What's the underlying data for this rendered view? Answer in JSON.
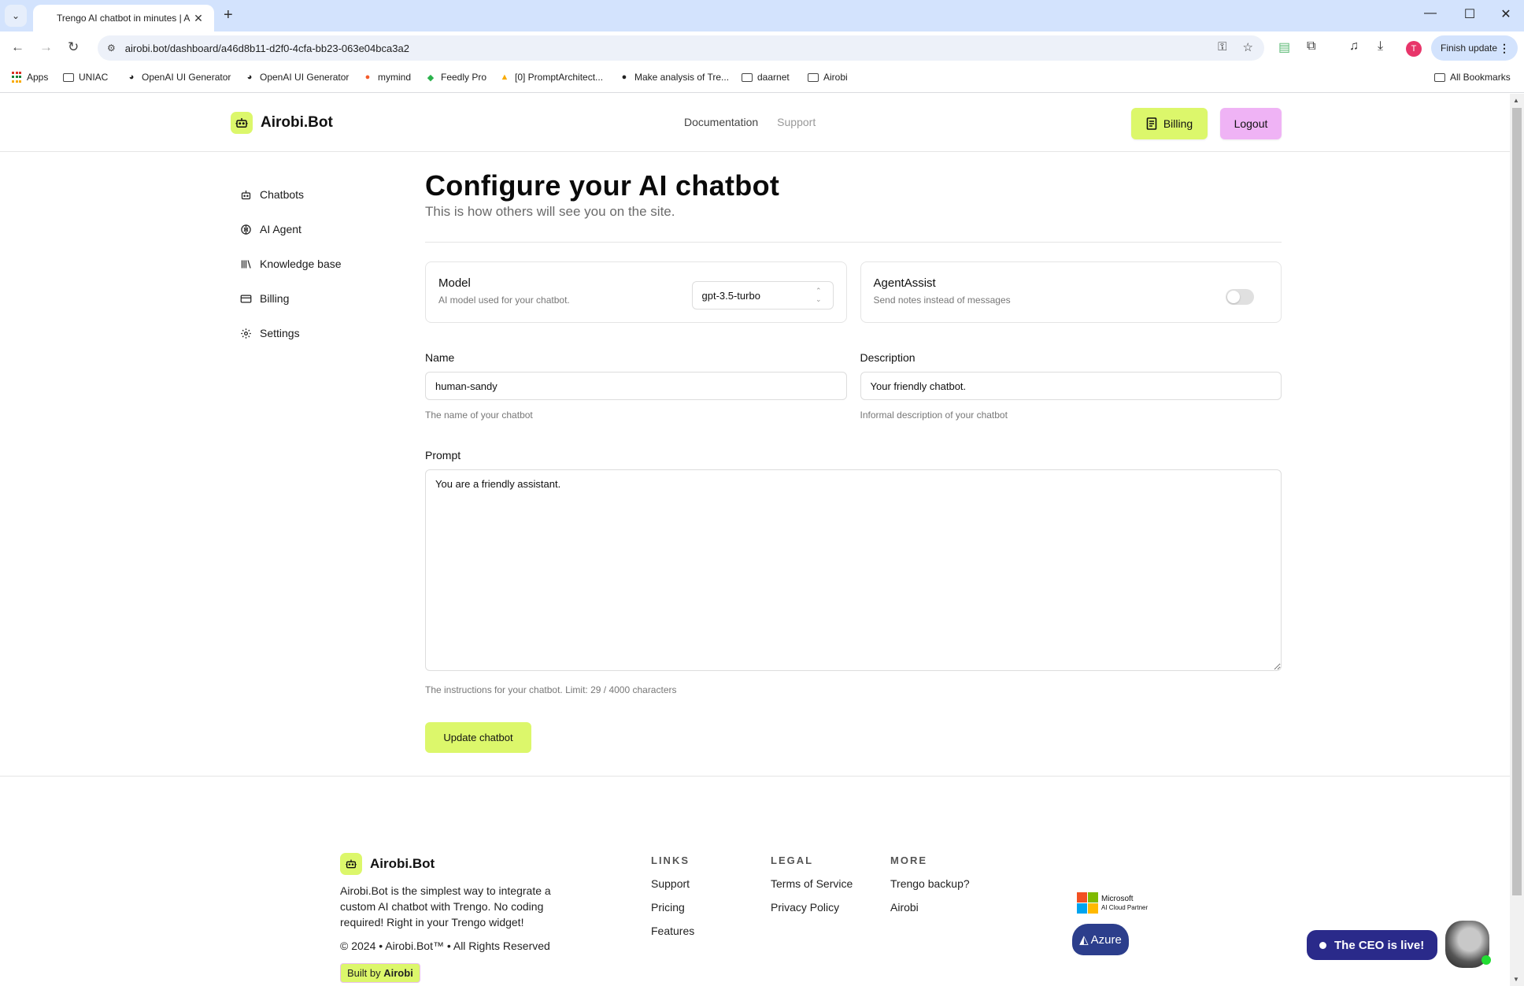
{
  "browser": {
    "tab_title": "Trengo AI chatbot in minutes | A",
    "url": "airobi.bot/dashboard/a46d8b11-d2f0-4cfa-bb23-063e04bca3a2",
    "finish_update_label": "Finish update",
    "profile_initial": "T",
    "bookmarks": [
      {
        "label": "Apps",
        "icon": "apps-grid-icon"
      },
      {
        "label": "UNIAC",
        "icon": "folder-icon"
      },
      {
        "label": "OpenAI UI Generator",
        "icon": "globe-icon"
      },
      {
        "label": "OpenAI UI Generator",
        "icon": "globe-icon"
      },
      {
        "label": "mymind",
        "icon": "mymind-icon"
      },
      {
        "label": "Feedly Pro",
        "icon": "feedly-icon"
      },
      {
        "label": "[0] PromptArchitect...",
        "icon": "drive-icon"
      },
      {
        "label": "Make analysis of Tre...",
        "icon": "github-icon"
      },
      {
        "label": "daarnet",
        "icon": "folder-icon"
      },
      {
        "label": "Airobi",
        "icon": "folder-icon"
      }
    ],
    "all_bookmarks_label": "All Bookmarks"
  },
  "header": {
    "brand": "Airobi.Bot",
    "nav": [
      {
        "label": "Documentation"
      },
      {
        "label": "Support"
      }
    ],
    "billing_label": "Billing",
    "logout_label": "Logout",
    "colors": {
      "lime": "#dcf76b",
      "pink": "#efb3f5"
    }
  },
  "sidebar": {
    "items": [
      {
        "label": "Chatbots",
        "icon": "robot-icon"
      },
      {
        "label": "AI Agent",
        "icon": "brain-icon"
      },
      {
        "label": "Knowledge base",
        "icon": "library-icon"
      },
      {
        "label": "Billing",
        "icon": "credit-card-icon"
      },
      {
        "label": "Settings",
        "icon": "gear-icon"
      }
    ]
  },
  "main": {
    "title": "Configure your AI chatbot",
    "subtitle": "This is how others will see you on the site.",
    "model_card": {
      "title": "Model",
      "description": "AI model used for your chatbot.",
      "selected": "gpt-3.5-turbo"
    },
    "agent_assist_card": {
      "title": "AgentAssist",
      "description": "Send notes instead of messages",
      "enabled": false
    },
    "name": {
      "label": "Name",
      "value": "human-sandy",
      "help": "The name of your chatbot"
    },
    "description": {
      "label": "Description",
      "value": "Your friendly chatbot.",
      "help": "Informal description of your chatbot"
    },
    "prompt": {
      "label": "Prompt",
      "value": "You are a friendly assistant.",
      "help": "The instructions for your chatbot. Limit: 29 / 4000 characters"
    },
    "update_button": "Update chatbot"
  },
  "footer": {
    "brand": "Airobi.Bot",
    "about": "Airobi.Bot is the simplest way to integrate a custom AI chatbot with Trengo. No coding required! Right in your Trengo widget!",
    "copyright": "© 2024 • Airobi.Bot™ • All Rights Reserved",
    "built_by_prefix": "Built by ",
    "built_by_name": "Airobi",
    "columns": [
      {
        "heading": "LINKS",
        "links": [
          "Support",
          "Pricing",
          "Features"
        ]
      },
      {
        "heading": "LEGAL",
        "links": [
          "Terms of Service",
          "Privacy Policy"
        ]
      },
      {
        "heading": "MORE",
        "links": [
          "Trengo backup?",
          "Airobi"
        ]
      }
    ],
    "microsoft_badge": {
      "line1": "Microsoft",
      "line2": "AI Cloud Partner"
    },
    "azure_badge": "Azure"
  },
  "chat_widget": {
    "label": "The CEO is live!",
    "color": "#2a2a8a"
  }
}
